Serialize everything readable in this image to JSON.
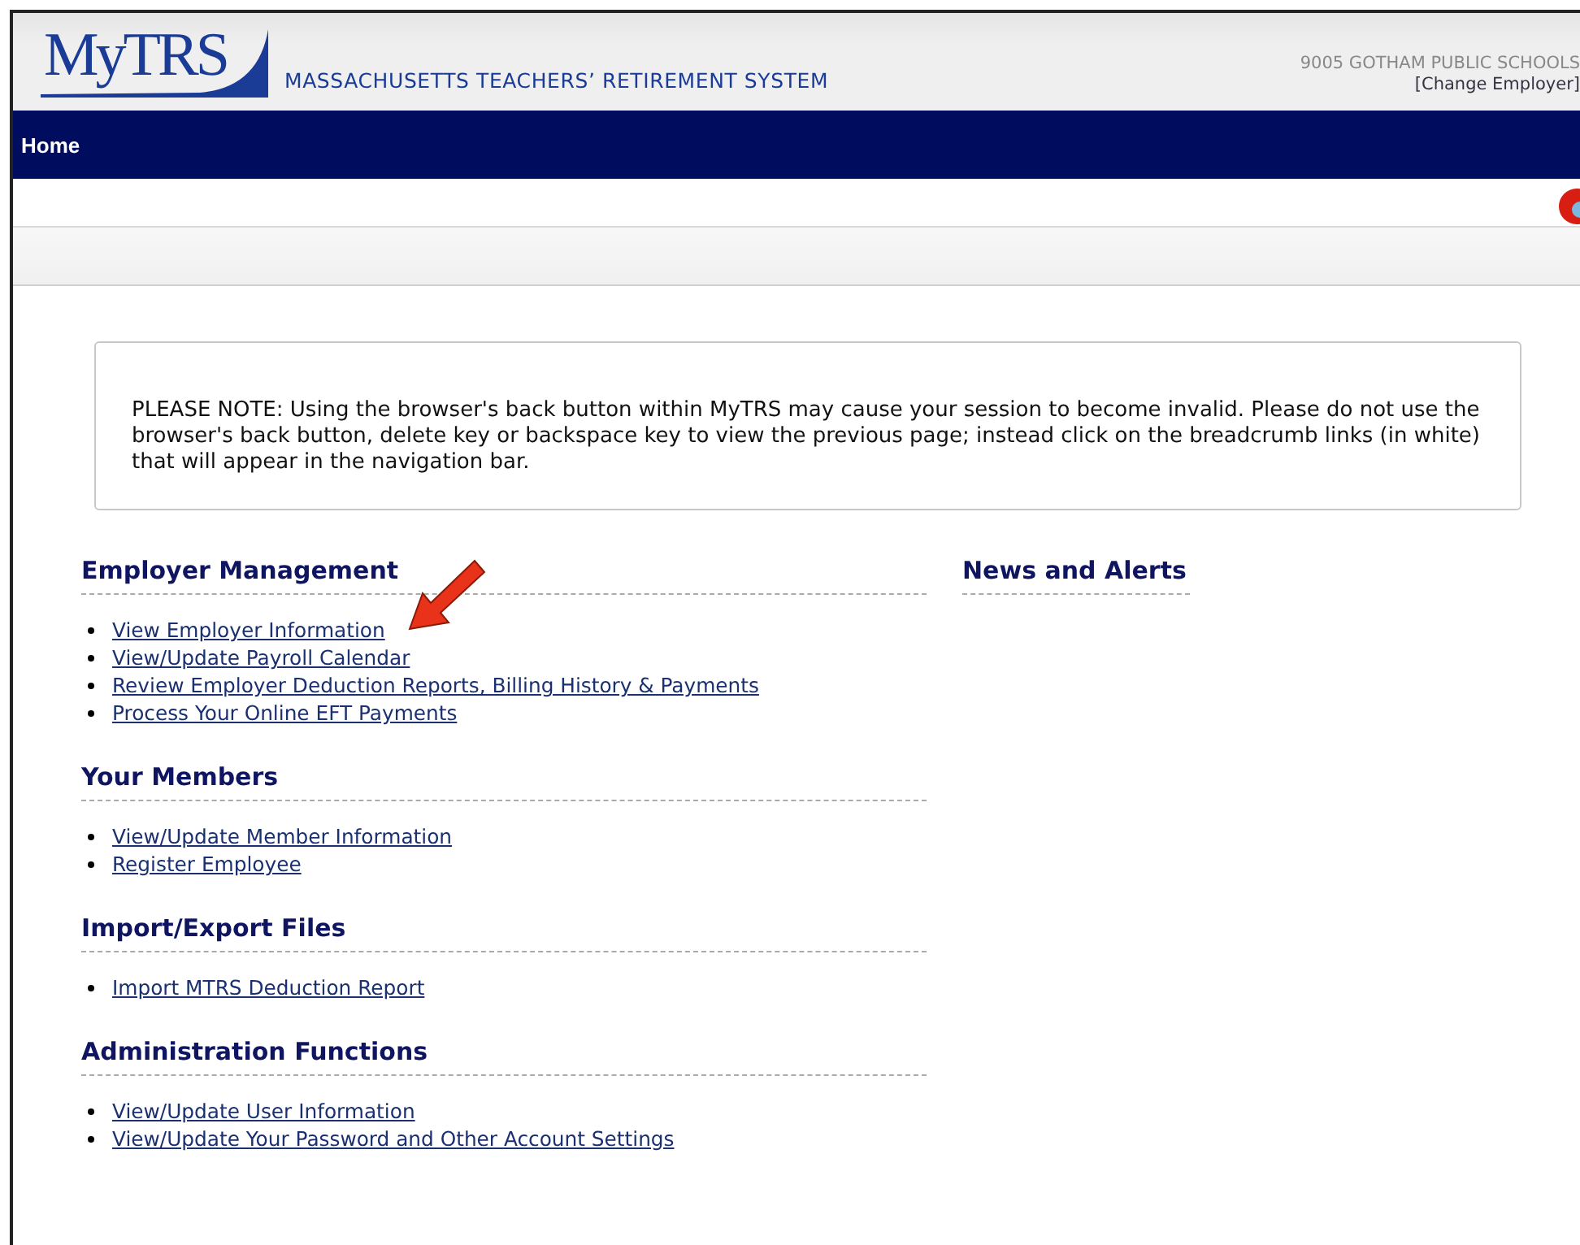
{
  "header": {
    "logo": "MyTRS",
    "system_name": "MASSACHUSETTS TEACHERS’ RETIREMENT SYSTEM",
    "employer": "9005 GOTHAM PUBLIC SCHOOLS",
    "change_link": "[Change Employer]"
  },
  "nav": {
    "items": [
      {
        "label": "Home",
        "selected": true
      }
    ]
  },
  "notice": "PLEASE NOTE: Using the browser's back button within MyTRS may cause your session to become invalid. Please do not use the browser's back button, delete key or backspace key to view the previous page; instead click on the breadcrumb links (in white) that will appear in the navigation bar.",
  "sections": [
    {
      "title": "Employer Management",
      "links": [
        {
          "label": "View Employer Information",
          "highlighted": true
        },
        {
          "label": "View/Update Payroll Calendar",
          "highlighted": false
        },
        {
          "label": "Review Employer Deduction Reports, Billing History & Payments",
          "highlighted": false
        },
        {
          "label": "Process Your Online EFT Payments",
          "highlighted": false
        }
      ]
    },
    {
      "title": "Your Members",
      "links": [
        {
          "label": "View/Update Member Information",
          "highlighted": false
        },
        {
          "label": "Register Employee",
          "highlighted": false
        }
      ]
    },
    {
      "title": "Import/Export Files",
      "links": [
        {
          "label": "Import MTRS Deduction Report",
          "highlighted": false
        }
      ]
    },
    {
      "title": "Administration Functions",
      "links": [
        {
          "label": "View/Update User Information",
          "highlighted": false
        },
        {
          "label": "View/Update Your Password and Other Account Settings",
          "highlighted": false
        }
      ]
    }
  ],
  "news": {
    "title": "News and Alerts"
  }
}
